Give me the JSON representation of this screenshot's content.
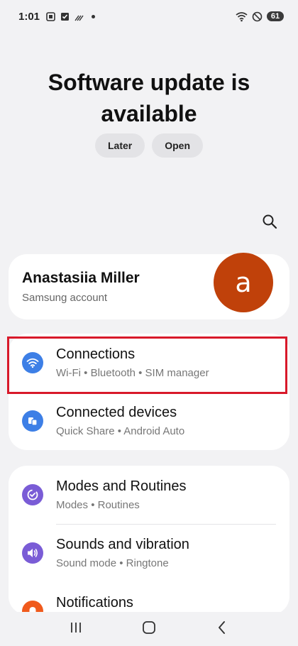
{
  "status_bar": {
    "time": "1:01",
    "left_icons": [
      "screenshot-icon",
      "checkbox-icon",
      "signal-icon",
      "dot-icon"
    ],
    "right_icons": [
      "wifi-icon",
      "do-not-disturb-icon"
    ],
    "battery": "61"
  },
  "update_banner": {
    "title_line1": "Software update is",
    "title_line2": "available",
    "later_label": "Later",
    "open_label": "Open"
  },
  "account": {
    "name": "Anastasiia Miller",
    "subtitle": "Samsung account",
    "avatar_letter": "a",
    "avatar_color": "#c0410a"
  },
  "settings_groups": [
    {
      "items": [
        {
          "title": "Connections",
          "subtitle": "Wi-Fi  •  Bluetooth  •  SIM manager",
          "icon": "wifi-icon",
          "color": "#3d7fe6"
        },
        {
          "title": "Connected devices",
          "subtitle": "Quick Share  •  Android Auto",
          "icon": "connected-devices-icon",
          "color": "#3d7fe6"
        }
      ]
    },
    {
      "items": [
        {
          "title": "Modes and Routines",
          "subtitle": "Modes  •  Routines",
          "icon": "modes-routines-icon",
          "color": "#7a5cd6"
        },
        {
          "title": "Sounds and vibration",
          "subtitle": "Sound mode  •  Ringtone",
          "icon": "volume-icon",
          "color": "#7a5cd6"
        },
        {
          "title": "Notifications",
          "subtitle": "",
          "icon": "notifications-icon",
          "color": "#f05a1c"
        }
      ]
    }
  ],
  "highlight_color": "#d8192a"
}
